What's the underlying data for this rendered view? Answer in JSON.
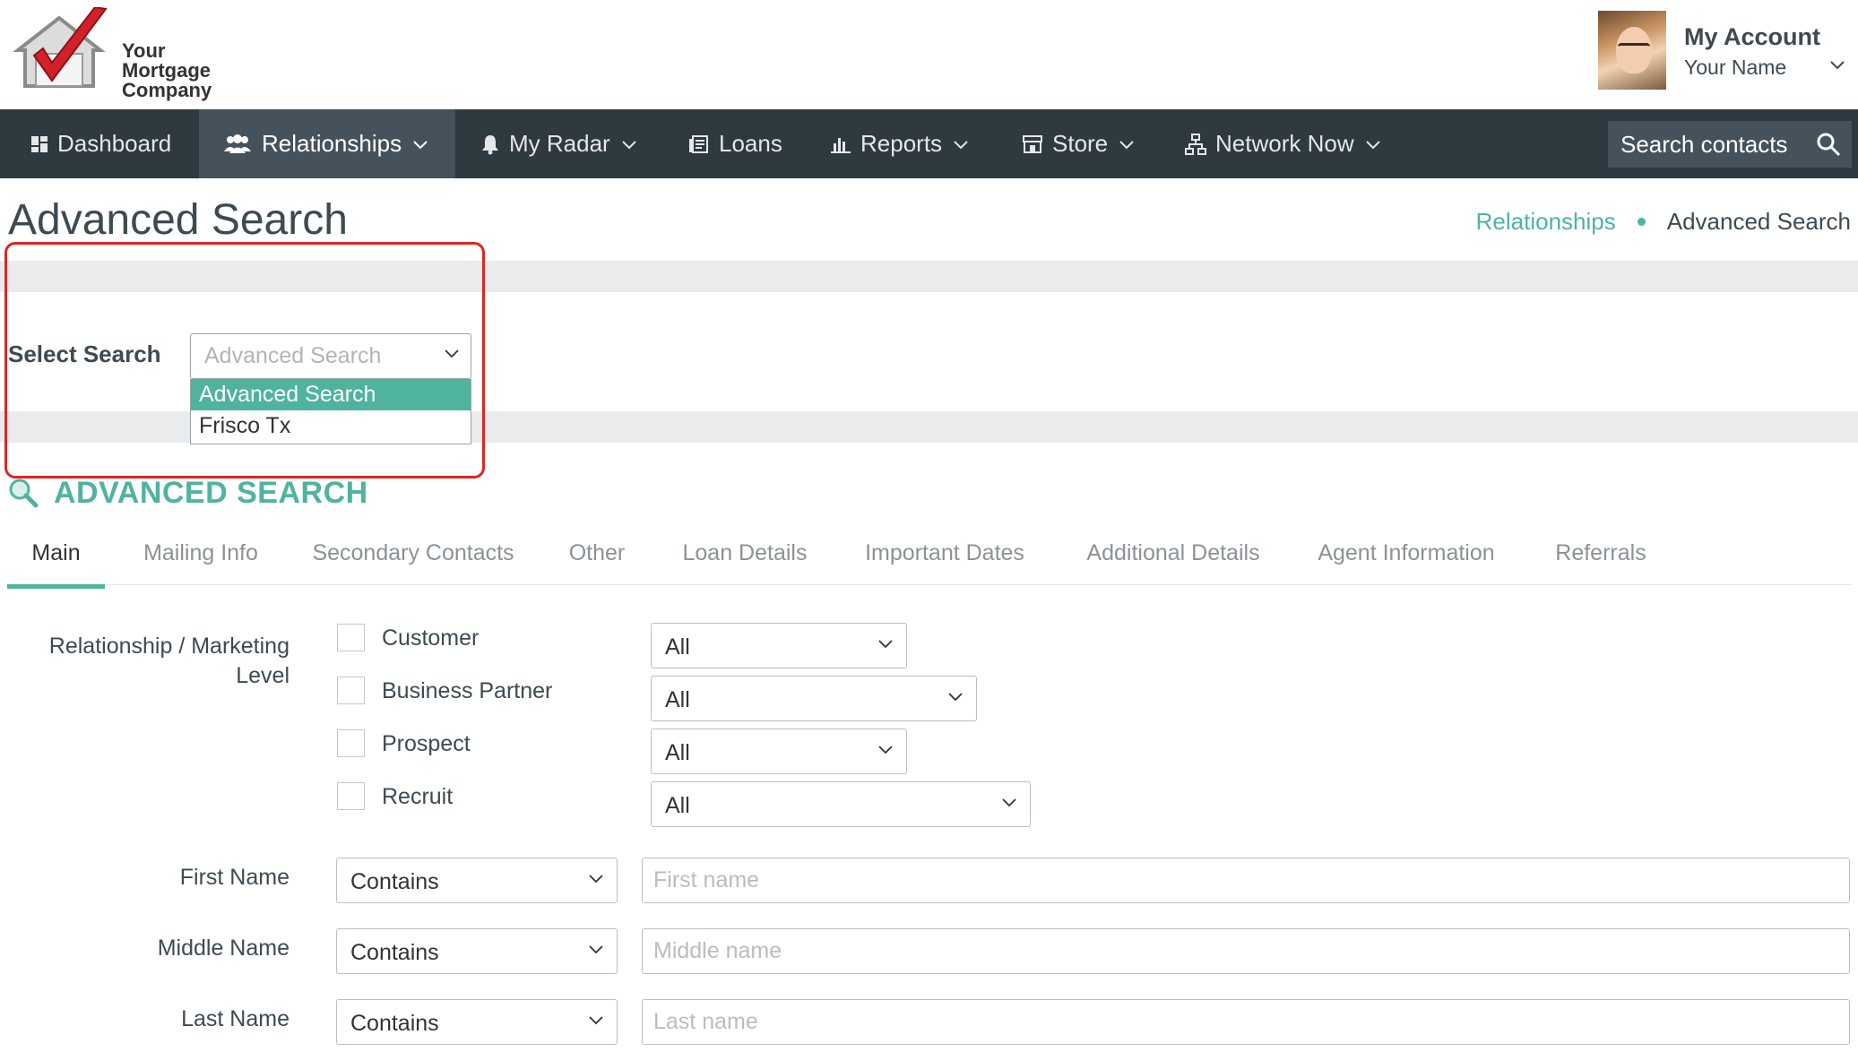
{
  "brand": {
    "logo_line1": "Your",
    "logo_line2": "Mortgage",
    "logo_line3": "Company"
  },
  "account": {
    "title": "My Account",
    "name": "Your Name"
  },
  "nav": {
    "items": [
      {
        "label": "Dashboard",
        "icon": "dashboard-icon"
      },
      {
        "label": "Relationships",
        "icon": "people-icon",
        "active": true
      },
      {
        "label": "My Radar",
        "icon": "bell-icon"
      },
      {
        "label": "Loans",
        "icon": "document-icon"
      },
      {
        "label": "Reports",
        "icon": "bar-chart-icon"
      },
      {
        "label": "Store",
        "icon": "store-icon"
      },
      {
        "label": "Network Now",
        "icon": "network-icon"
      }
    ],
    "search_placeholder": "Search contacts"
  },
  "page": {
    "title": "Advanced Search"
  },
  "breadcrumb": {
    "parent": "Relationships",
    "current": "Advanced Search"
  },
  "select_search": {
    "label": "Select Search",
    "value": "Advanced Search",
    "options": [
      "Advanced Search",
      "Frisco Tx"
    ],
    "selected_index": 0
  },
  "section": {
    "title": "ADVANCED SEARCH"
  },
  "tabs": [
    "Main",
    "Mailing Info",
    "Secondary Contacts",
    "Other",
    "Loan Details",
    "Important Dates",
    "Additional Details",
    "Agent Information",
    "Referrals"
  ],
  "form": {
    "relationship_label_line1": "Relationship / Marketing",
    "relationship_label_line2": "Level",
    "relationship_types": [
      {
        "label": "Customer",
        "checked": false,
        "level": "All"
      },
      {
        "label": "Business Partner",
        "checked": false,
        "level": "All"
      },
      {
        "label": "Prospect",
        "checked": false,
        "level": "All"
      },
      {
        "label": "Recruit",
        "checked": false,
        "level": "All"
      }
    ],
    "name_fields": [
      {
        "label": "First Name",
        "operator": "Contains",
        "placeholder": "First name"
      },
      {
        "label": "Middle Name",
        "operator": "Contains",
        "placeholder": "Middle name"
      },
      {
        "label": "Last Name",
        "operator": "Contains",
        "placeholder": "Last name"
      }
    ]
  },
  "colors": {
    "accent": "#4fb3a0",
    "nav_bg": "#2f3940",
    "nav_active": "#46525b",
    "highlight": "#e02424"
  }
}
